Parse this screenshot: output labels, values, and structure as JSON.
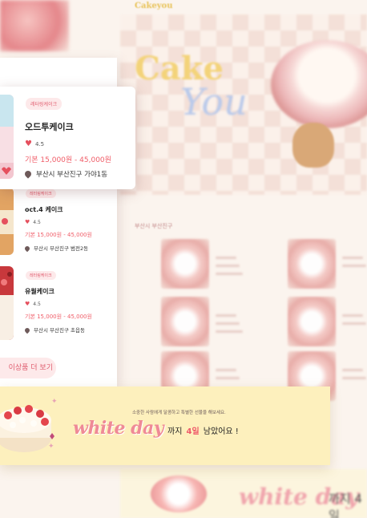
{
  "background": {
    "logo": "Cakeyou",
    "hero_word_1": "Cake",
    "hero_word_2": "You",
    "location": "부산시 부산진구",
    "bottom_banner_word": "white day",
    "bottom_banner_tail": "까지 4일"
  },
  "products": [
    {
      "badge": "레터링케이크",
      "name": "오드투케이크",
      "rating": "4.5",
      "price": "기본 15,000원 - 45,000원",
      "location": "부산시 부산진구 가야1동"
    },
    {
      "badge": "레터링케이크",
      "name": "oct.4 케이크",
      "rating": "4.5",
      "price": "기본 15,000원 - 45,000원",
      "location": "부산시 부산진구 범전2동"
    },
    {
      "badge": "레터링케이크",
      "name": "유월케이크",
      "rating": "4.5",
      "price": "기본 15,000원 - 45,000원",
      "location": "부산시 부산진구 초읍동"
    }
  ],
  "more_button": "이상품 더 보기",
  "banner": {
    "subtitle": "소중한 사람에게 달콤하고 특별한 선물을 해보세요.",
    "title": "white day",
    "msg_prefix": "까지",
    "days": "4일",
    "msg_suffix": "남았어요 !"
  },
  "colors": {
    "accent": "#ef5a6a",
    "badge_bg": "#fde9ea",
    "banner_bg": "#fdf0bd"
  }
}
